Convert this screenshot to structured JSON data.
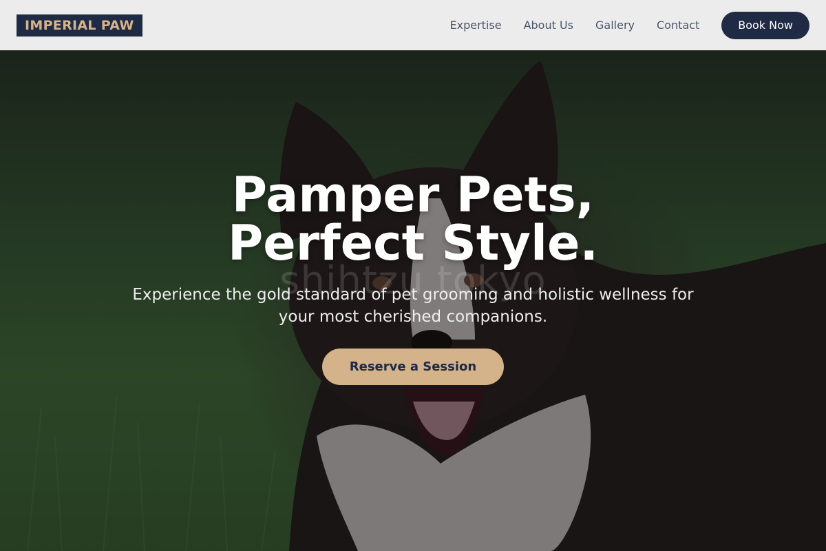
{
  "header": {
    "logo": "IMPERIAL PAW",
    "nav": [
      {
        "label": "Expertise"
      },
      {
        "label": "About Us"
      },
      {
        "label": "Gallery"
      },
      {
        "label": "Contact"
      }
    ],
    "cta": "Book Now"
  },
  "hero": {
    "title_line1": "Pamper Pets,",
    "title_line2": "Perfect Style.",
    "subtitle": "Experience the gold standard of pet grooming and holistic wellness for your most cherished companions.",
    "watermark": "shihtzu tokyo",
    "button": "Reserve a Session",
    "image_subject": "border-collie-dog"
  },
  "colors": {
    "navy": "#1f2a44",
    "gold": "#d4b28a",
    "header_bg": "#ececec",
    "nav_text": "#4a5568"
  }
}
